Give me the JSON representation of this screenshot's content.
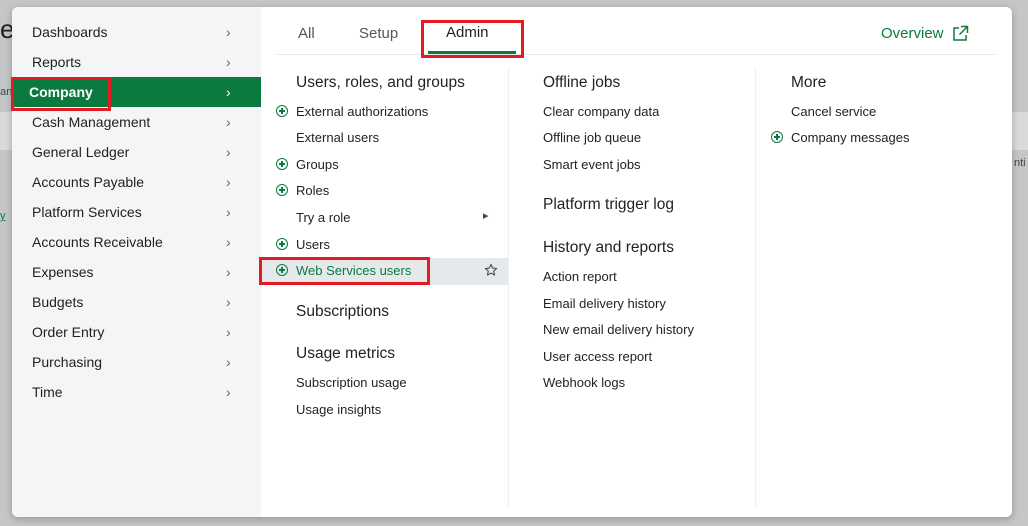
{
  "background": {
    "title_fragment": "e",
    "left_fragment": "an",
    "right_fragment": "nti",
    "link_fragment": "y"
  },
  "sidebar": {
    "items": [
      {
        "label": "Dashboards",
        "chevron": "›"
      },
      {
        "label": "Reports",
        "chevron": "›"
      },
      {
        "label": "Company",
        "chevron": "›",
        "active": true
      },
      {
        "label": "Cash Management",
        "chevron": "›"
      },
      {
        "label": "General Ledger",
        "chevron": "›"
      },
      {
        "label": "Accounts Payable",
        "chevron": "›"
      },
      {
        "label": "Platform Services",
        "chevron": "›"
      },
      {
        "label": "Accounts Receivable",
        "chevron": "›"
      },
      {
        "label": "Expenses",
        "chevron": "›"
      },
      {
        "label": "Budgets",
        "chevron": "›"
      },
      {
        "label": "Order Entry",
        "chevron": "›"
      },
      {
        "label": "Purchasing",
        "chevron": "›"
      },
      {
        "label": "Time",
        "chevron": "›"
      }
    ]
  },
  "tabs": {
    "all": "All",
    "setup": "Setup",
    "admin": "Admin",
    "active": "Admin"
  },
  "overview_label": "Overview",
  "columns": {
    "col1": {
      "users_roles_heading": "Users, roles, and groups",
      "items": [
        {
          "label": "External authorizations",
          "plus": true
        },
        {
          "label": "External users",
          "plus": false
        },
        {
          "label": "Groups",
          "plus": true
        },
        {
          "label": "Roles",
          "plus": true
        },
        {
          "label": "Try a role",
          "plus": false,
          "submenu_arrow": "▸"
        },
        {
          "label": "Users",
          "plus": true
        },
        {
          "label": "Web Services users",
          "plus": true,
          "highlighted": true
        }
      ],
      "subscriptions_heading": "Subscriptions",
      "usage_heading": "Usage metrics",
      "usage_items": [
        "Subscription usage",
        "Usage insights"
      ]
    },
    "col2": {
      "offline_heading": "Offline jobs",
      "offline_items": [
        "Clear company data",
        "Offline job queue",
        "Smart event jobs"
      ],
      "platform_heading": "Platform trigger log",
      "history_heading": "History and reports",
      "history_items": [
        "Action report",
        "Email delivery history",
        "New email delivery history",
        "User access report",
        "Webhook logs"
      ]
    },
    "col3": {
      "more_heading": "More",
      "items": [
        {
          "label": "Cancel service",
          "plus": false
        },
        {
          "label": "Company messages",
          "plus": true
        }
      ]
    }
  },
  "icons": {
    "plus": "plus-circle-icon",
    "star": "star-outline-icon",
    "external": "external-link-icon",
    "chevron": "chevron-right-icon"
  },
  "colors": {
    "accent": "#0a7a3e",
    "highlight_box": "#e31b23"
  }
}
